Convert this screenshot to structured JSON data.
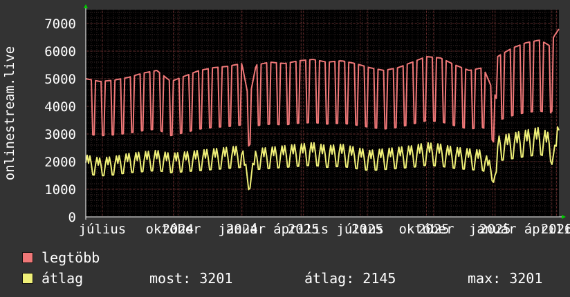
{
  "colors": {
    "background": "#333333",
    "plot_background": "#000000",
    "grid_minor": "#3a2a2a",
    "grid_major": "#6a2c2c",
    "axis": "#ffffff",
    "arrow": "#00cc00",
    "max_series": "#f07878",
    "avg_series": "#f0f078"
  },
  "chart_data": {
    "type": "line",
    "ylabel": "onlinestream.live",
    "ylim": [
      0,
      7500
    ],
    "yticks": [
      0,
      1000,
      2000,
      3000,
      4000,
      5000,
      6000,
      7000
    ],
    "ytick_labels": [
      "0",
      "1000",
      "2000",
      "3000",
      "4000",
      "5000",
      "6000",
      "7000"
    ],
    "xticks": [
      {
        "label": "július",
        "x": 0.035
      },
      {
        "label": "október",
        "x": 0.185
      },
      {
        "label": "2024",
        "x": 0.195
      },
      {
        "label": "január",
        "x": 0.33
      },
      {
        "label": "2024",
        "x": 0.33
      },
      {
        "label": "április",
        "x": 0.455
      },
      {
        "label": "2025",
        "x": 0.46
      },
      {
        "label": "július",
        "x": 0.58
      },
      {
        "label": "2025",
        "x": 0.595
      },
      {
        "label": "október",
        "x": 0.72
      },
      {
        "label": "2025",
        "x": 0.735
      },
      {
        "label": "január",
        "x": 0.86
      },
      {
        "label": "2025",
        "x": 0.865
      },
      {
        "label": "április",
        "x": 0.985
      },
      {
        "label": "2026",
        "x": 0.995
      }
    ],
    "grid": true,
    "legend_placement": "bottom",
    "series": [
      {
        "name": "legtöbb",
        "color": "#f07878",
        "x": [
          0.0,
          0.03,
          0.06,
          0.09,
          0.12,
          0.15,
          0.18,
          0.21,
          0.24,
          0.27,
          0.3,
          0.33,
          0.345,
          0.36,
          0.39,
          0.42,
          0.45,
          0.48,
          0.51,
          0.54,
          0.57,
          0.6,
          0.63,
          0.66,
          0.69,
          0.72,
          0.75,
          0.78,
          0.81,
          0.84,
          0.87,
          0.87,
          0.9,
          0.93,
          0.96,
          0.98,
          0.99,
          1.0
        ],
        "values": [
          5000,
          4900,
          4950,
          5050,
          5200,
          5300,
          4900,
          5100,
          5300,
          5400,
          5450,
          5550,
          4200,
          5500,
          5600,
          5550,
          5650,
          5700,
          5600,
          5650,
          5550,
          5400,
          5300,
          5400,
          5600,
          5800,
          5750,
          5500,
          5300,
          5400,
          4200,
          5800,
          6100,
          6300,
          6400,
          6200,
          6550,
          6800
        ]
      },
      {
        "name": "átlag",
        "color": "#f0f078",
        "x": [
          0.0,
          0.03,
          0.06,
          0.09,
          0.12,
          0.15,
          0.18,
          0.21,
          0.24,
          0.27,
          0.3,
          0.33,
          0.345,
          0.36,
          0.39,
          0.42,
          0.45,
          0.48,
          0.51,
          0.54,
          0.57,
          0.6,
          0.63,
          0.66,
          0.69,
          0.72,
          0.75,
          0.78,
          0.81,
          0.84,
          0.87,
          0.87,
          0.9,
          0.93,
          0.96,
          0.98,
          0.99,
          1.0
        ],
        "values": [
          2000,
          1900,
          1950,
          2050,
          2100,
          2150,
          2050,
          2100,
          2150,
          2200,
          2250,
          2300,
          1200,
          2200,
          2250,
          2300,
          2350,
          2400,
          2300,
          2350,
          2250,
          2150,
          2200,
          2250,
          2300,
          2400,
          2350,
          2250,
          2200,
          2150,
          1400,
          2600,
          2700,
          2800,
          2900,
          2700,
          2200,
          3200
        ]
      }
    ]
  },
  "legend": {
    "items": [
      {
        "label": "legtöbb",
        "color": "#f07878"
      },
      {
        "label": "átlag",
        "color": "#f0f078"
      }
    ],
    "stats": {
      "most": "most: 3201",
      "atlag": "átlag: 2145",
      "max": "max: 3201"
    }
  }
}
